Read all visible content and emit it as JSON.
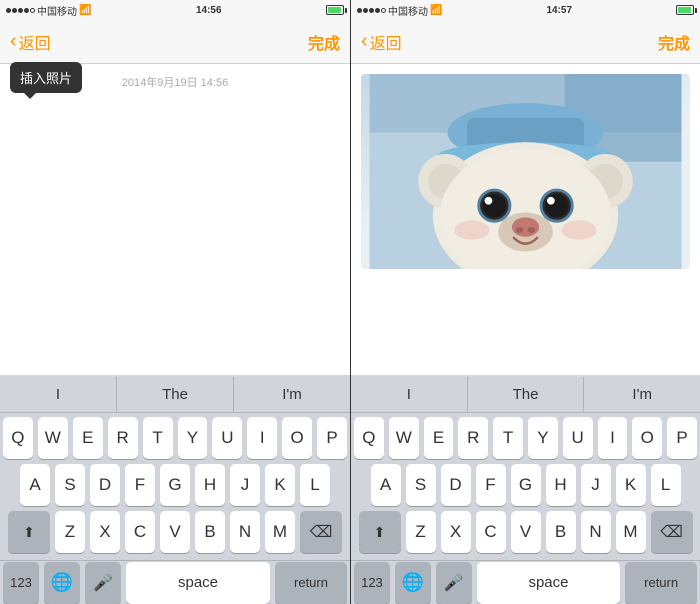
{
  "panel1": {
    "status": {
      "carrier": "中国移动",
      "wifi": "WiFi",
      "time": "14:56",
      "signal_bars": 5,
      "battery": "charging"
    },
    "nav": {
      "back_label": "返回",
      "done_label": "完成"
    },
    "tooltip": "插入照片",
    "timestamp": "2014年9月19日 14:56",
    "has_image": false
  },
  "panel2": {
    "status": {
      "carrier": "中国移动",
      "wifi": "WiFi",
      "time": "14:57",
      "signal_bars": 5,
      "battery": "charged"
    },
    "nav": {
      "back_label": "返回",
      "done_label": "完成"
    },
    "has_image": true
  },
  "keyboard": {
    "autocomplete": [
      "I",
      "The",
      "I'm"
    ],
    "rows": [
      [
        "Q",
        "W",
        "E",
        "R",
        "T",
        "Y",
        "U",
        "I",
        "O",
        "P"
      ],
      [
        "A",
        "S",
        "D",
        "F",
        "G",
        "H",
        "J",
        "K",
        "L"
      ],
      [
        "Z",
        "X",
        "C",
        "V",
        "B",
        "N",
        "M"
      ]
    ],
    "bottom": {
      "num_label": "123",
      "globe_label": "🌐",
      "mic_label": "🎤",
      "space_label": "space",
      "return_label": "return"
    }
  }
}
